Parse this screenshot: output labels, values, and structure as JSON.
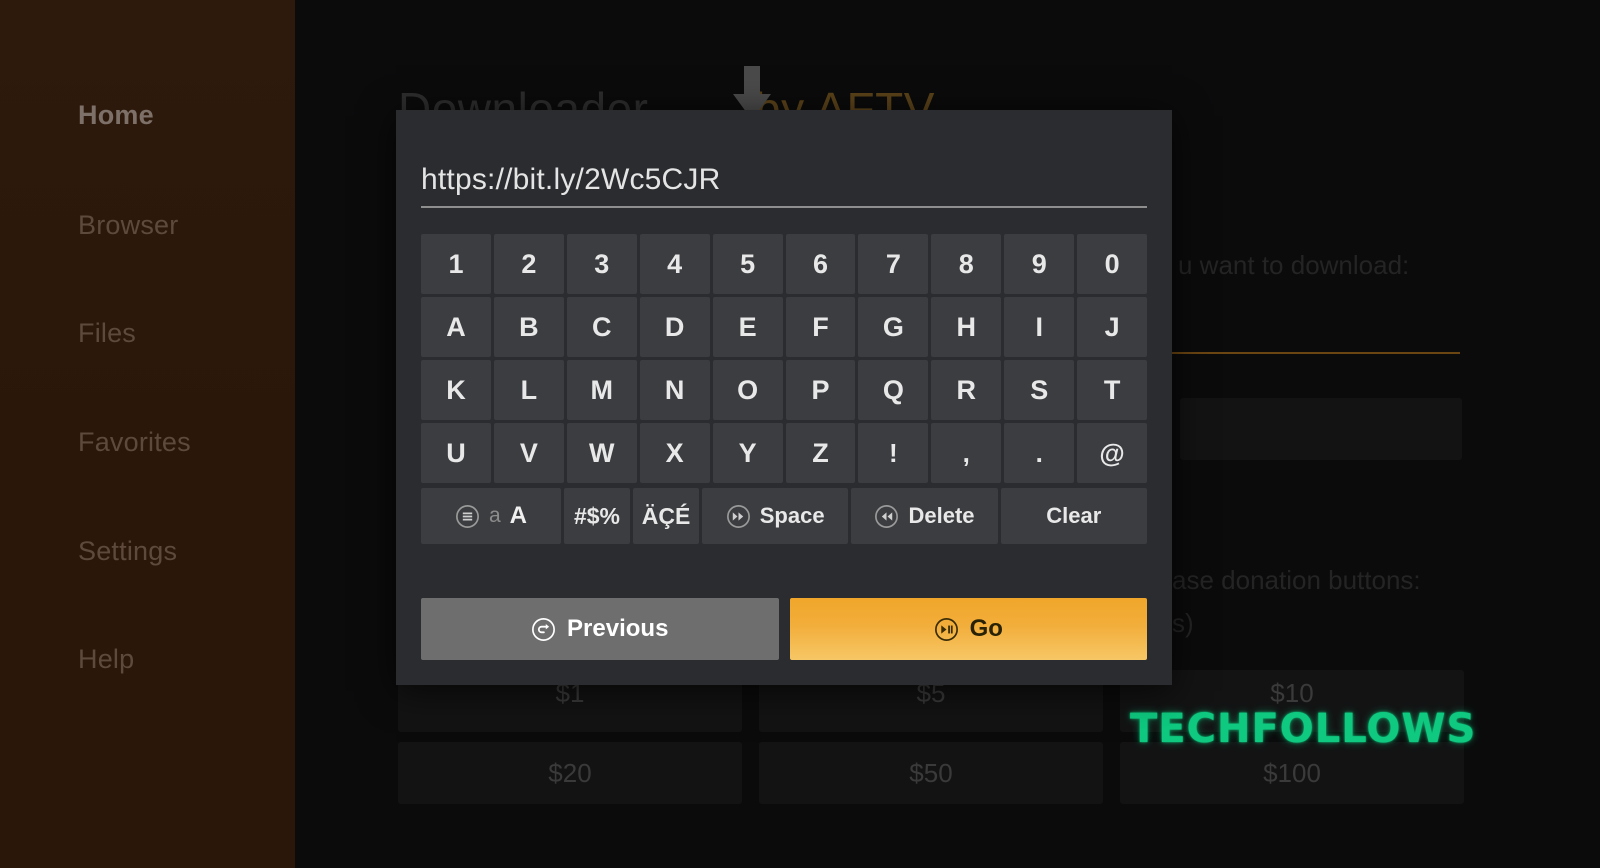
{
  "app": {
    "title": "Downloader",
    "title_accent": "by AFTV",
    "sidebar": {
      "items": [
        {
          "label": "Home",
          "active": true
        },
        {
          "label": "Browser",
          "active": false
        },
        {
          "label": "Files",
          "active": false
        },
        {
          "label": "Favorites",
          "active": false
        },
        {
          "label": "Settings",
          "active": false
        },
        {
          "label": "Help",
          "active": false
        }
      ]
    },
    "background": {
      "download_prompt": "u want to download:",
      "donation_prompt": "ase donation buttons:",
      "donation_subtext": "s)",
      "donation_amounts": [
        "$1",
        "$5",
        "$10",
        "$20",
        "$50",
        "$100"
      ]
    },
    "watermark": "TECHFOLLOWS"
  },
  "dialog": {
    "url_value": "https://bit.ly/2Wc5CJR",
    "keyboard": {
      "rows": [
        [
          "1",
          "2",
          "3",
          "4",
          "5",
          "6",
          "7",
          "8",
          "9",
          "0"
        ],
        [
          "A",
          "B",
          "C",
          "D",
          "E",
          "F",
          "G",
          "H",
          "I",
          "J"
        ],
        [
          "K",
          "L",
          "M",
          "N",
          "O",
          "P",
          "Q",
          "R",
          "S",
          "T"
        ],
        [
          "U",
          "V",
          "W",
          "X",
          "Y",
          "Z",
          "!",
          ",",
          ".",
          "@"
        ]
      ],
      "function_keys": {
        "shift_lower": "a",
        "shift_upper": "A",
        "symbols": "#$%",
        "accents": "ÄÇÉ",
        "space": "Space",
        "delete": "Delete",
        "clear": "Clear"
      }
    },
    "actions": {
      "previous": "Previous",
      "go": "Go"
    }
  },
  "colors": {
    "accent_orange": "#f2ae3b",
    "dialog_bg": "#2a2c2f",
    "key_bg": "#3b3d40",
    "sidebar_bg": "#2b170a",
    "watermark_green": "#0ec97f"
  }
}
